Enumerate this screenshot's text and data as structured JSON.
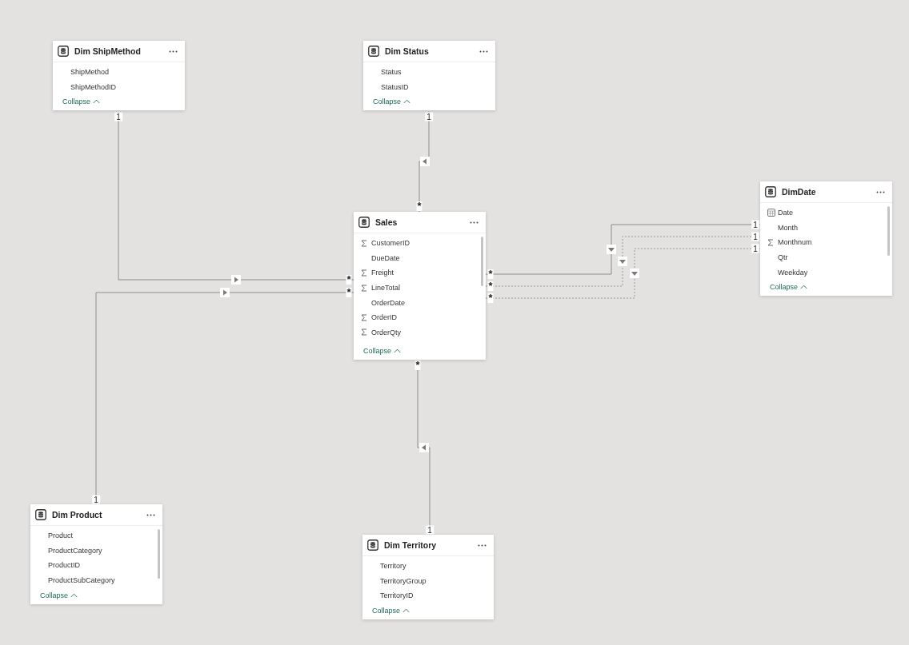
{
  "tables": [
    {
      "name": "Dim ShipMethod",
      "fields": [
        {
          "name": "ShipMethod",
          "kind": "plain"
        },
        {
          "name": "ShipMethodID",
          "kind": "plain"
        }
      ],
      "collapse": "Collapse"
    },
    {
      "name": "Dim Status",
      "fields": [
        {
          "name": "Status",
          "kind": "plain"
        },
        {
          "name": "StatusID",
          "kind": "plain"
        }
      ],
      "collapse": "Collapse"
    },
    {
      "name": "Sales",
      "fields": [
        {
          "name": "CustomerID",
          "kind": "sum"
        },
        {
          "name": "DueDate",
          "kind": "plain"
        },
        {
          "name": "Freight",
          "kind": "sum"
        },
        {
          "name": "LineTotal",
          "kind": "sum"
        },
        {
          "name": "OrderDate",
          "kind": "plain"
        },
        {
          "name": "OrderID",
          "kind": "sum"
        },
        {
          "name": "OrderQty",
          "kind": "sum"
        }
      ],
      "collapse": "Collapse"
    },
    {
      "name": "DimDate",
      "fields": [
        {
          "name": "Date",
          "kind": "date"
        },
        {
          "name": "Month",
          "kind": "plain"
        },
        {
          "name": "Monthnum",
          "kind": "sum"
        },
        {
          "name": "Qtr",
          "kind": "plain"
        },
        {
          "name": "Weekday",
          "kind": "plain"
        }
      ],
      "collapse": "Collapse"
    },
    {
      "name": "Dim Product",
      "fields": [
        {
          "name": "Product",
          "kind": "plain"
        },
        {
          "name": "ProductCategory",
          "kind": "plain"
        },
        {
          "name": "ProductID",
          "kind": "plain"
        },
        {
          "name": "ProductSubCategory",
          "kind": "plain"
        }
      ],
      "collapse": "Collapse"
    },
    {
      "name": "Dim Territory",
      "fields": [
        {
          "name": "Territory",
          "kind": "plain"
        },
        {
          "name": "TerritoryGroup",
          "kind": "plain"
        },
        {
          "name": "TerritoryID",
          "kind": "plain"
        }
      ],
      "collapse": "Collapse"
    }
  ],
  "relationships": [
    {
      "many_label": "*",
      "one_label": "1",
      "active": true
    },
    {
      "many_label": "*",
      "one_label": "1",
      "active": true
    },
    {
      "many_label": "*",
      "one_label": "1",
      "active": true
    },
    {
      "many_label": "*",
      "one_label": "1",
      "active": true
    },
    {
      "many_label": "*",
      "one_label": "1",
      "active": true
    },
    {
      "many_label": "*",
      "one_label": "1",
      "active": false
    },
    {
      "many_label": "*",
      "one_label": "1",
      "active": false
    }
  ]
}
